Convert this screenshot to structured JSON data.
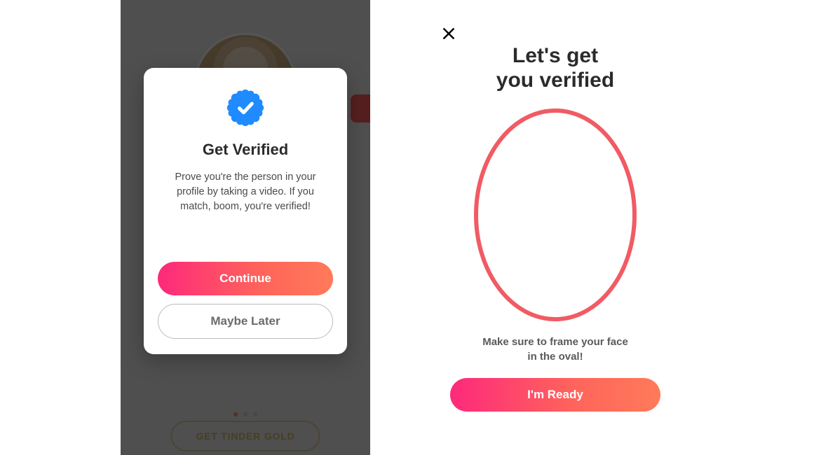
{
  "left": {
    "background": {
      "gold_button_label": "GET TINDER GOLD"
    },
    "modal": {
      "title": "Get Verified",
      "body": "Prove you're the person in your profile by taking a video. If you match, boom, you're verified!",
      "continue_label": "Continue",
      "later_label": "Maybe Later"
    }
  },
  "right": {
    "title_line1": "Let's get",
    "title_line2": "you verified",
    "hint_line1": "Make sure to frame your face",
    "hint_line2": "in the oval!",
    "ready_label": "I'm Ready"
  },
  "colors": {
    "badge_blue": "#1f8bff",
    "oval_stroke": "#f15b64"
  }
}
